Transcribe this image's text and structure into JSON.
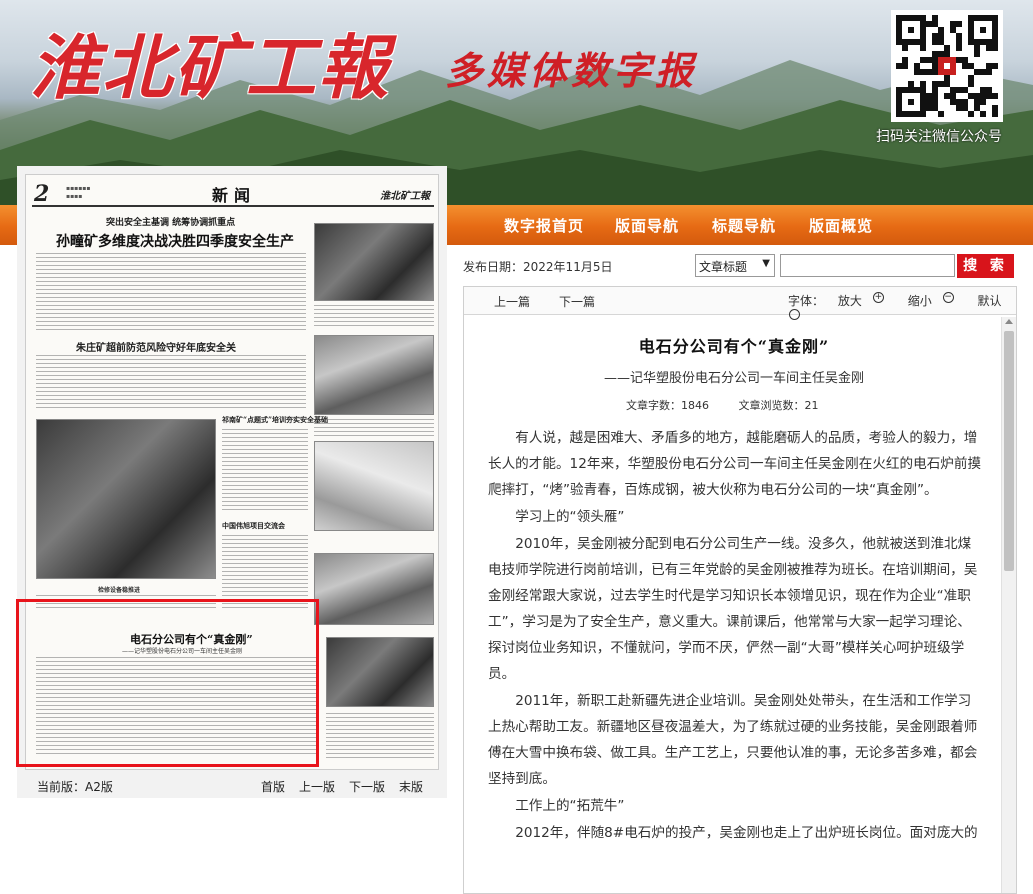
{
  "header": {
    "logo_text": "淮北矿工報",
    "subtitle": "多媒体数字报",
    "qr_caption": "扫码关注微信公众号"
  },
  "nav": {
    "items": [
      "数字报首页",
      "版面导航",
      "标题导航",
      "版面概览"
    ]
  },
  "toolbar": {
    "pub_label": "发布日期：",
    "pub_date": "2022年11月5日",
    "select_value": "文章标题",
    "search_button": "搜 索"
  },
  "paper": {
    "page_number": "2",
    "section": "新闻",
    "masthead": "淮北矿工報",
    "kicker": "突出安全主基调  统筹协调抓重点",
    "headline_main": "孙疃矿多维度决战决胜四季度安全生产",
    "headline_second": "朱庄矿超前防范风险守好年底安全关",
    "photo_caption": "检修设备稳推进",
    "article_title": "电石分公司有个“真金刚”",
    "article_subtitle": "——记华塑股份电石分公司一车间主任吴金刚"
  },
  "pager": {
    "current_label": "当前版：A2版",
    "first": "首版",
    "prev": "上一版",
    "next": "下一版",
    "last": "末版"
  },
  "article_toolbar": {
    "prev": "上一篇",
    "next": "下一篇",
    "font_label": "字体：",
    "zoom_in": "放大",
    "zoom_out": "缩小",
    "default": "默认"
  },
  "article": {
    "title": "电石分公司有个“真金刚”",
    "subtitle": "——记华塑股份电石分公司一车间主任吴金刚",
    "word_count": "文章字数：1846",
    "view_count": "文章浏览数：21",
    "paragraphs": [
      "有人说，越是困难大、矛盾多的地方，越能磨砺人的品质，考验人的毅力，增长人的才能。12年来，华塑股份电石分公司一车间主任吴金刚在火红的电石炉前摸爬摔打，“烤”验青春，百炼成钢，被大伙称为电石分公司的一块“真金刚”。",
      "学习上的“领头雁”",
      "2010年，吴金刚被分配到电石分公司生产一线。没多久，他就被送到淮北煤电技师学院进行岗前培训，已有三年党龄的吴金刚被推荐为班长。在培训期间，吴金刚经常跟大家说，过去学生时代是学习知识长本领增见识，现在作为企业“准职工”，学习是为了安全生产，意义重大。课前课后，他常常与大家一起学习理论、探讨岗位业务知识，不懂就问，学而不厌，俨然一副“大哥”模样关心呵护班级学员。",
      "2011年，新职工赴新疆先进企业培训。吴金刚处处带头，在生活和工作学习上热心帮助工友。新疆地区昼夜温差大，为了练就过硬的业务技能，吴金刚跟着师傅在大雪中换布袋、做工具。生产工艺上，只要他认准的事，无论多苦多难，都会坚持到底。",
      "工作上的“拓荒牛”",
      "2012年，伴随8#电石炉的投产，吴金刚也走上了出炉班长岗位。面对庞大的"
    ]
  }
}
